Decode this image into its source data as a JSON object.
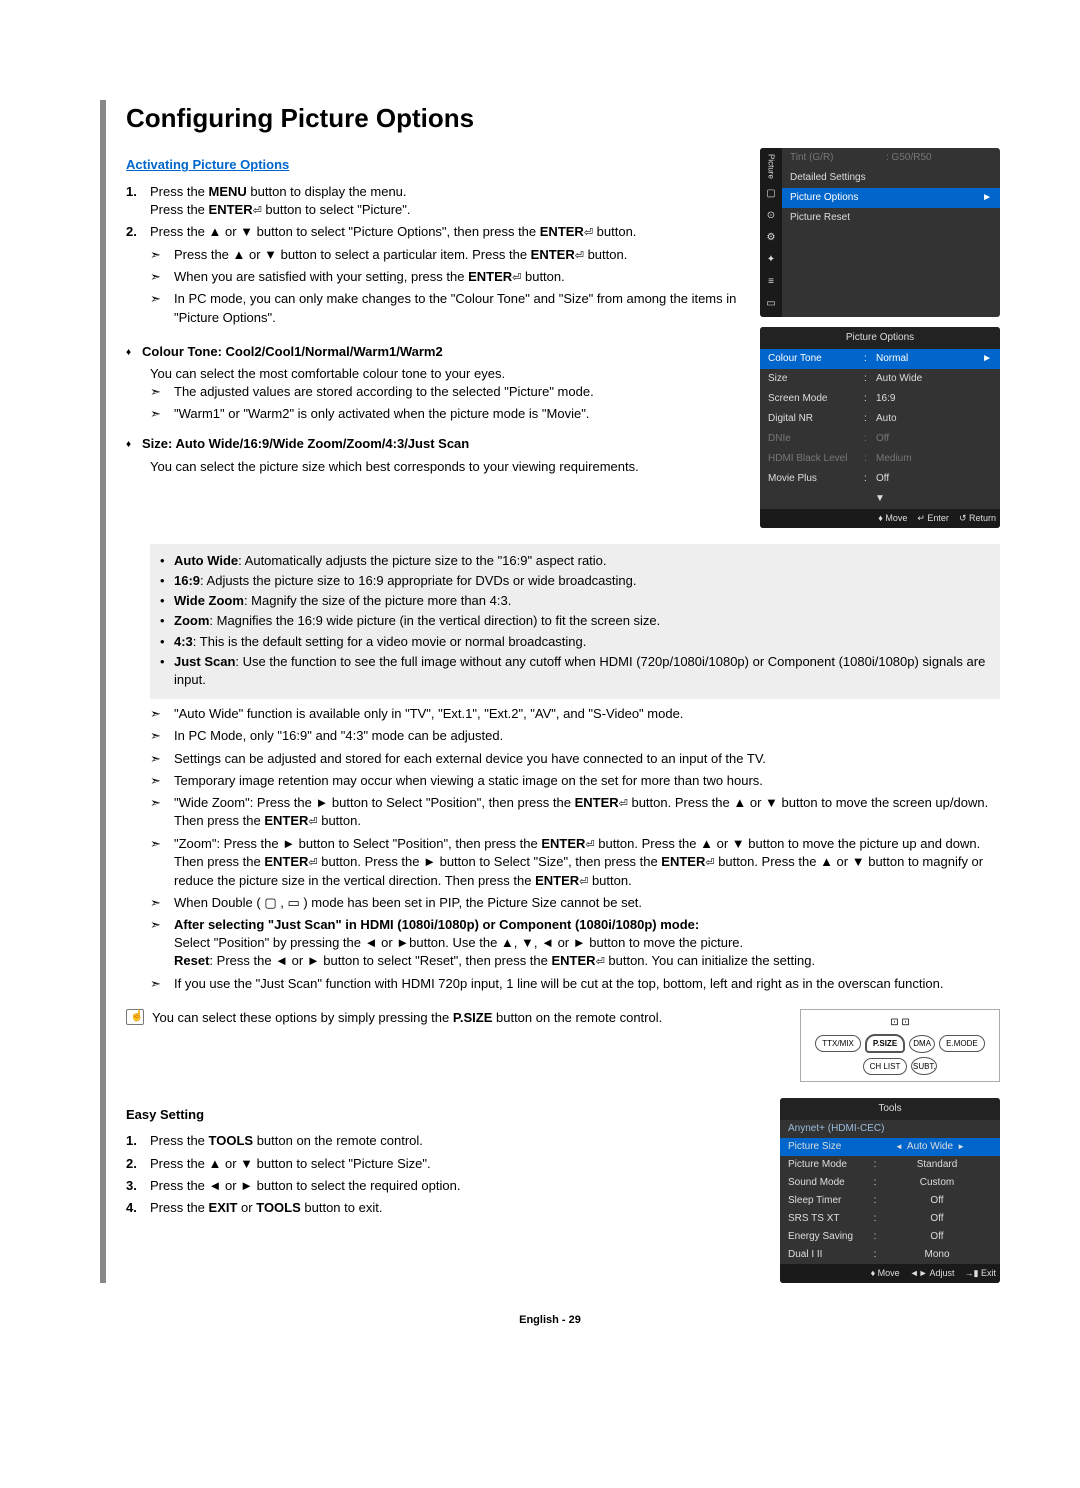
{
  "title": "Configuring Picture Options",
  "section_activating": "Activating Picture Options",
  "step1a": "Press the ",
  "step1a_b": "MENU",
  "step1a_end": " button to display the menu.",
  "step1b": "Press the ",
  "step1b_b": "ENTER",
  "step1b_end": " button to select \"Picture\".",
  "step2a": "Press the ▲ or ▼ button to select \"Picture Options\", then press the ",
  "step2a_b": "ENTER",
  "step2a_end": " button.",
  "arr1a": "Press the ▲ or ▼ button to select a particular item. Press the ",
  "arr1a_b": "ENTER",
  "arr1a_end": " button.",
  "arr2a": "When you are satisfied with your setting, press the ",
  "arr2a_b": "ENTER",
  "arr2a_end": " button.",
  "arr3": "In PC mode, you can only make changes to the \"Colour Tone\" and \"Size\" from among the items in \"Picture Options\".",
  "d1_title": "Colour Tone: Cool2/Cool1/Normal/Warm1/Warm2",
  "d1_text": "You can select the most comfortable colour tone to your eyes.",
  "d1_a1": "The adjusted values are stored according to the selected \"Picture\" mode.",
  "d1_a2": "\"Warm1\" or \"Warm2\" is only activated when the picture mode is \"Movie\".",
  "d2_title": "Size: Auto Wide/16:9/Wide Zoom/Zoom/4:3/Just Scan",
  "d2_text": "You can select the picture size which best corresponds to your viewing requirements.",
  "s_aw_b": "Auto Wide",
  "s_aw": ": Automatically adjusts the picture size to the \"16:9\" aspect ratio.",
  "s_169_b": "16:9",
  "s_169": ": Adjusts the picture size to 16:9 appropriate for DVDs or wide broadcasting.",
  "s_wz_b": "Wide Zoom",
  "s_wz": ": Magnify the size of the picture more than 4:3.",
  "s_z_b": "Zoom",
  "s_z": ": Magnifies the 16:9 wide picture (in the vertical direction) to fit the screen size.",
  "s_43_b": "4:3",
  "s_43": ": This is the default setting for a video movie or normal broadcasting.",
  "s_js_b": "Just Scan",
  "s_js": ": Use the function to see the full image without any cutoff when HDMI (720p/1080i/1080p) or Component (1080i/1080p) signals are input.",
  "n1": "\"Auto Wide\" function is available only in \"TV\", \"Ext.1\", \"Ext.2\", \"AV\", and \"S-Video\" mode.",
  "n2": "In PC Mode, only \"16:9\" and \"4:3\" mode can be adjusted.",
  "n3": "Settings can be adjusted and stored for each external device you have connected to an input of the TV.",
  "n4": "Temporary image retention may occur when viewing a static image on the set for more than two hours.",
  "n5a": "\"Wide Zoom\": Press the ► button to Select \"Position\", then press the ",
  "n5b": "ENTER",
  "n5c": " button. Press the ▲ or ▼ button to move the screen up/down. Then press the ",
  "n5d": "ENTER",
  "n5e": " button.",
  "n6a": "\"Zoom\": Press the ► button to Select \"Position\", then press the ",
  "n6b": "ENTER",
  "n6c": " button. Press the ▲ or ▼ button to move the picture up and down. Then press the ",
  "n6d": "ENTER",
  "n6e": " button. Press the ► button to Select \"Size\", then press the ",
  "n6f": "ENTER",
  "n6g": " button. Press the ▲ or ▼ button to magnify or reduce the picture size in the vertical direction. Then press the ",
  "n6h": "ENTER",
  "n6i": " button.",
  "n7": "When Double ( ▢ , ▭ ) mode has been set in PIP, the Picture Size cannot be set.",
  "n8_b": "After selecting \"Just Scan\" in HDMI (1080i/1080p) or Component (1080i/1080p) mode:",
  "n8_1": "Select \"Position\" by pressing the ◄ or ►button. Use the ▲, ▼, ◄ or ► button to move the picture.",
  "n8_2b": "Reset",
  "n8_2a": ": Press the ◄ or ► button to select \"Reset\", then press the ",
  "n8_2c": "ENTER",
  "n8_2d": " button. You can initialize the setting.",
  "n9": "If you use the \"Just Scan\" function with HDMI 720p input, 1 line will be cut at the top, bottom, left and right as in the overscan function.",
  "psize_a": "You can select these options by simply pressing the ",
  "psize_b": "P.SIZE",
  "psize_c": " button on the remote control.",
  "easy_title": "Easy Setting",
  "e1a": "Press the ",
  "e1b": "TOOLS",
  "e1c": " button on the remote control.",
  "e2": "Press the ▲ or ▼ button to select \"Picture Size\".",
  "e3": "Press the ◄ or ► button to select the required option.",
  "e4a": "Press the ",
  "e4b": "EXIT",
  "e4c": " or ",
  "e4d": "TOOLS",
  "e4e": " button to exit.",
  "footer": "English - 29",
  "osd1": {
    "tint_l": "Tint (G/R)",
    "tint_v": ": G50/R50",
    "det": "Detailed Settings",
    "po": "Picture Options",
    "pr": "Picture Reset"
  },
  "osd2": {
    "title": "Picture Options",
    "r": [
      {
        "l": "Colour Tone",
        "v": "Normal"
      },
      {
        "l": "Size",
        "v": "Auto Wide"
      },
      {
        "l": "Screen Mode",
        "v": "16:9"
      },
      {
        "l": "Digital NR",
        "v": "Auto"
      },
      {
        "l": "DNIe",
        "v": "Off"
      },
      {
        "l": "HDMI Black Level",
        "v": "Medium"
      },
      {
        "l": "Movie Plus",
        "v": "Off"
      }
    ],
    "f_move": "♦ Move",
    "f_enter": "↵ Enter",
    "f_return": "↺ Return"
  },
  "remote": {
    "ttx": "TTX/MIX",
    "psize": "P.SIZE",
    "dma": "DMA",
    "emode": "E.MODE",
    "chlist": "CH LIST",
    "subt": "SUBT."
  },
  "tools": {
    "title": "Tools",
    "anynet": "Anynet+ (HDMI-CEC)",
    "rows": [
      {
        "l": "Picture Size",
        "v": "Auto Wide",
        "sel": true
      },
      {
        "l": "Picture Mode",
        "v": "Standard"
      },
      {
        "l": "Sound Mode",
        "v": "Custom"
      },
      {
        "l": "Sleep Timer",
        "v": "Off"
      },
      {
        "l": "SRS TS XT",
        "v": "Off"
      },
      {
        "l": "Energy Saving",
        "v": "Off"
      },
      {
        "l": "Dual I II",
        "v": "Mono"
      }
    ],
    "f_move": "♦ Move",
    "f_adjust": "◄► Adjust",
    "f_exit": "→▮ Exit"
  }
}
